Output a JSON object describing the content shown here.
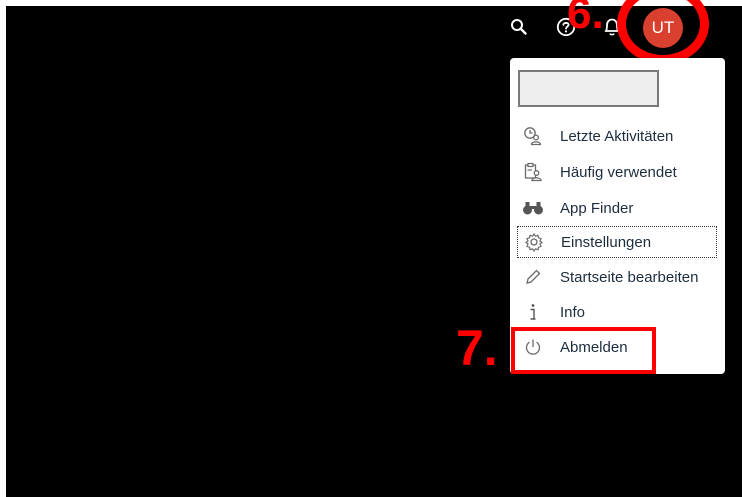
{
  "shellbar": {
    "icons": [
      "search-icon",
      "help-icon",
      "notifications-icon"
    ],
    "avatar_initials": "UT",
    "avatar_color": "#d9402f"
  },
  "menu": {
    "search_value": "",
    "items": [
      {
        "label": "Letzte Aktivitäten",
        "icon": "recent-activity-icon"
      },
      {
        "label": "Häufig verwendet",
        "icon": "frequently-used-icon"
      },
      {
        "label": "App Finder",
        "icon": "binoculars-icon"
      },
      {
        "label": "Einstellungen",
        "icon": "settings-icon",
        "focused": true
      },
      {
        "label": "Startseite bearbeiten",
        "icon": "pencil-icon"
      },
      {
        "label": "Info",
        "icon": "info-icon"
      },
      {
        "label": "Abmelden",
        "icon": "power-icon"
      }
    ]
  },
  "annotations": {
    "step6": "6.",
    "step7": "7.",
    "highlight_color": "#ff0000"
  }
}
